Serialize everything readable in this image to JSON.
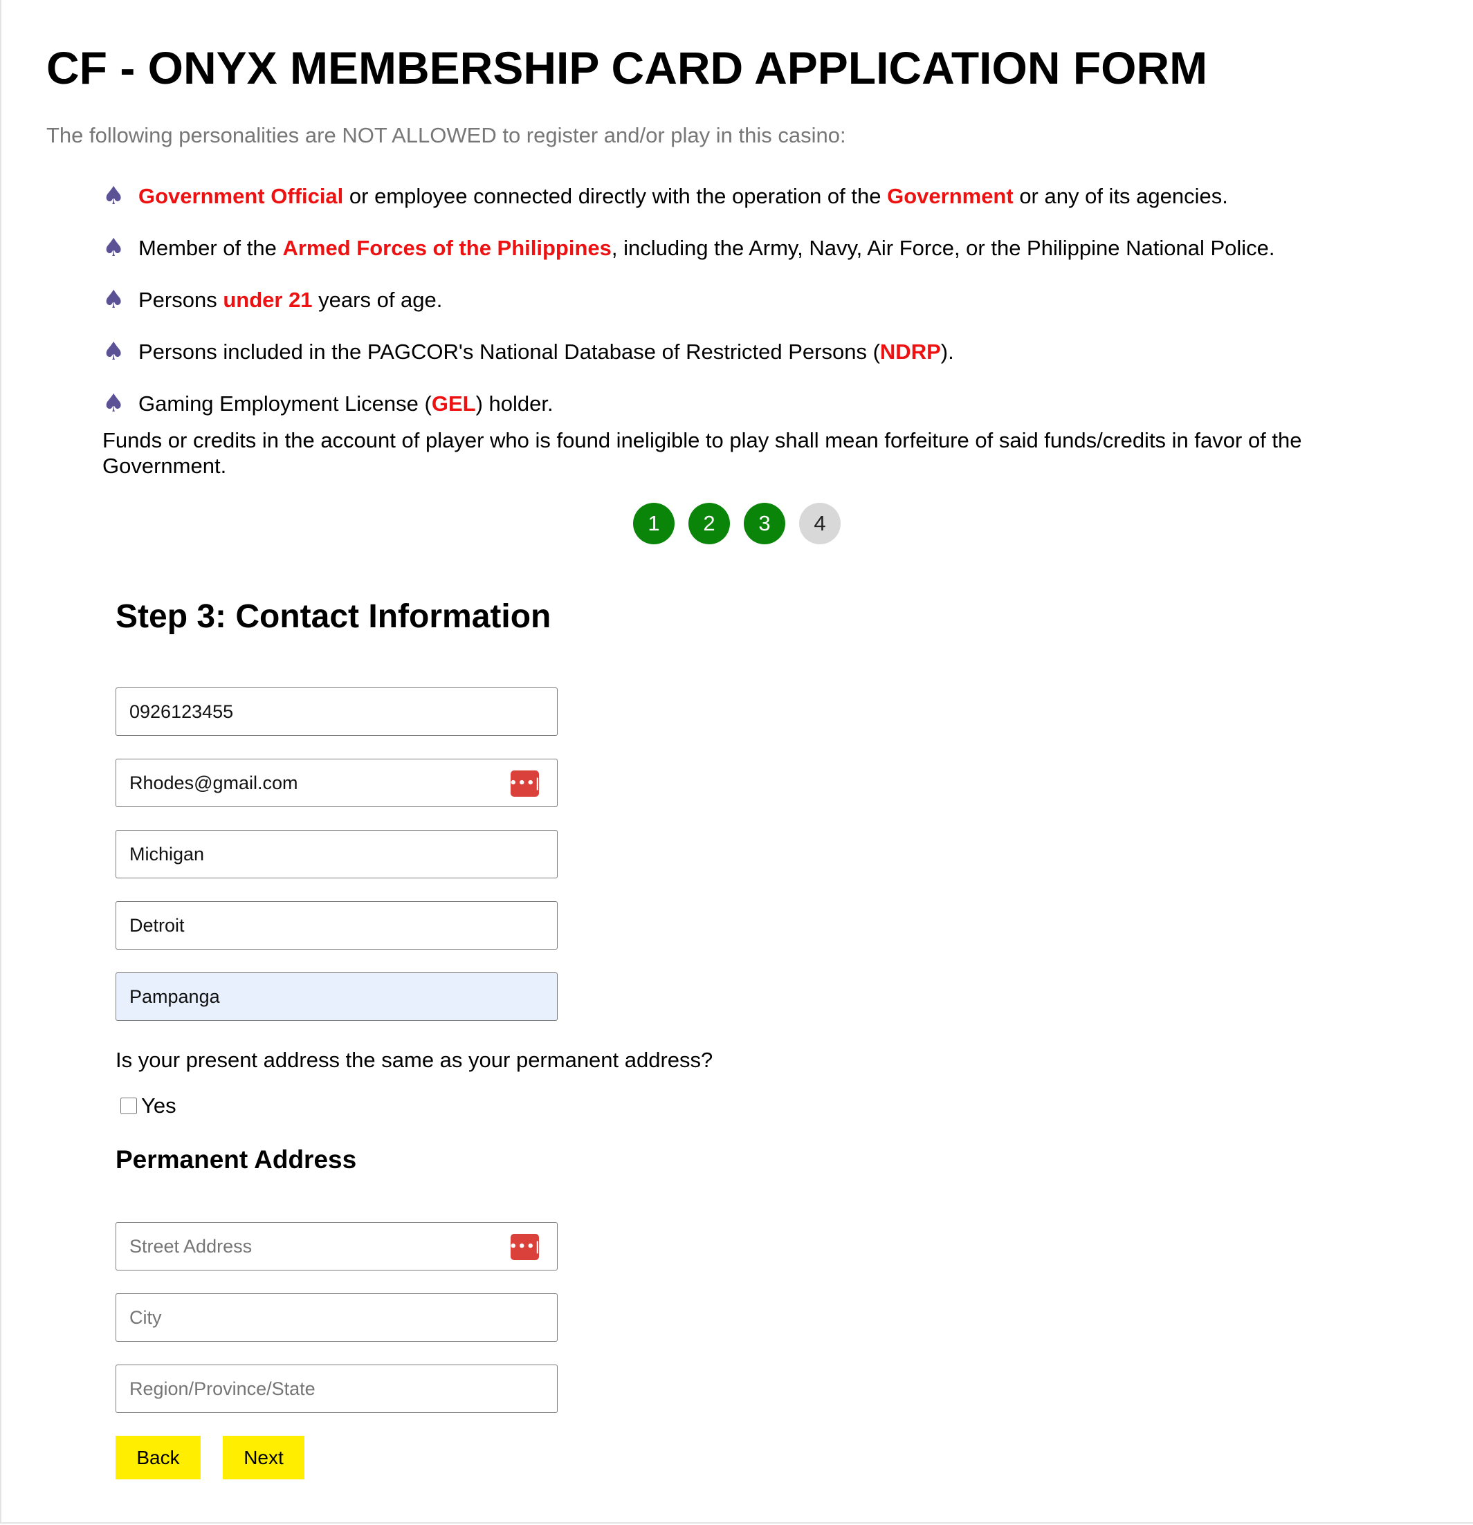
{
  "page": {
    "title": "CF - ONYX MEMBERSHIP CARD APPLICATION FORM",
    "intro": "The following personalities are NOT ALLOWED to register and/or play in this casino:",
    "bullet_icon": "spade-icon",
    "highlight_color": "#ee1111",
    "restrictions": [
      {
        "parts": [
          {
            "text": "Government Official",
            "highlight": true
          },
          {
            "text": " or employee connected directly with the operation of the ",
            "highlight": false
          },
          {
            "text": "Government",
            "highlight": true
          },
          {
            "text": " or any of its agencies.",
            "highlight": false
          }
        ]
      },
      {
        "parts": [
          {
            "text": "Member of the ",
            "highlight": false
          },
          {
            "text": "Armed Forces of the Philippines",
            "highlight": true
          },
          {
            "text": ", including the Army, Navy, Air Force, or the Philippine National Police.",
            "highlight": false
          }
        ]
      },
      {
        "parts": [
          {
            "text": "Persons ",
            "highlight": false
          },
          {
            "text": "under 21",
            "highlight": true
          },
          {
            "text": " years of age.",
            "highlight": false
          }
        ]
      },
      {
        "parts": [
          {
            "text": "Persons included in the PAGCOR's National Database of Restricted Persons (",
            "highlight": false
          },
          {
            "text": "NDRP",
            "highlight": true
          },
          {
            "text": ").",
            "highlight": false
          }
        ]
      },
      {
        "parts": [
          {
            "text": "Gaming Employment License (",
            "highlight": false
          },
          {
            "text": "GEL",
            "highlight": true
          },
          {
            "text": ") holder.",
            "highlight": false
          }
        ]
      }
    ],
    "forfeiture_notice": "Funds or credits in the account of player who is found ineligible to play shall mean forfeiture of said funds/credits in favor of the Government."
  },
  "stepper": {
    "steps": [
      {
        "label": "1",
        "status": "complete"
      },
      {
        "label": "2",
        "status": "complete"
      },
      {
        "label": "3",
        "status": "complete"
      },
      {
        "label": "4",
        "status": "pending"
      }
    ],
    "complete_color": "#0a850a",
    "pending_color": "#d8d8d8"
  },
  "form": {
    "section_title": "Step 3: Contact Information",
    "contact_fields": [
      {
        "name": "mobile-number-input",
        "value": "0926123455",
        "placeholder": "",
        "autofilled": false,
        "password_manager_icon": false
      },
      {
        "name": "email-input",
        "value": "Rhodes@gmail.com",
        "placeholder": "",
        "autofilled": false,
        "password_manager_icon": true
      },
      {
        "name": "present-region-input",
        "value": "Michigan",
        "placeholder": "",
        "autofilled": false,
        "password_manager_icon": false
      },
      {
        "name": "present-city-input",
        "value": "Detroit",
        "placeholder": "",
        "autofilled": false,
        "password_manager_icon": false
      },
      {
        "name": "present-province-input",
        "value": "Pampanga",
        "placeholder": "",
        "autofilled": true,
        "password_manager_icon": false
      }
    ],
    "same_address_question": "Is your present address the same as your permanent address?",
    "same_address_checkbox": {
      "label": "Yes",
      "checked": false
    },
    "permanent_address": {
      "title": "Permanent Address",
      "fields": [
        {
          "name": "permanent-street-input",
          "value": "",
          "placeholder": "Street Address",
          "password_manager_icon": true
        },
        {
          "name": "permanent-city-input",
          "value": "",
          "placeholder": "City",
          "password_manager_icon": false
        },
        {
          "name": "permanent-region-input",
          "value": "",
          "placeholder": "Region/Province/State",
          "password_manager_icon": false
        }
      ]
    },
    "buttons": {
      "back_label": "Back",
      "next_label": "Next",
      "color": "#ffee00"
    }
  }
}
